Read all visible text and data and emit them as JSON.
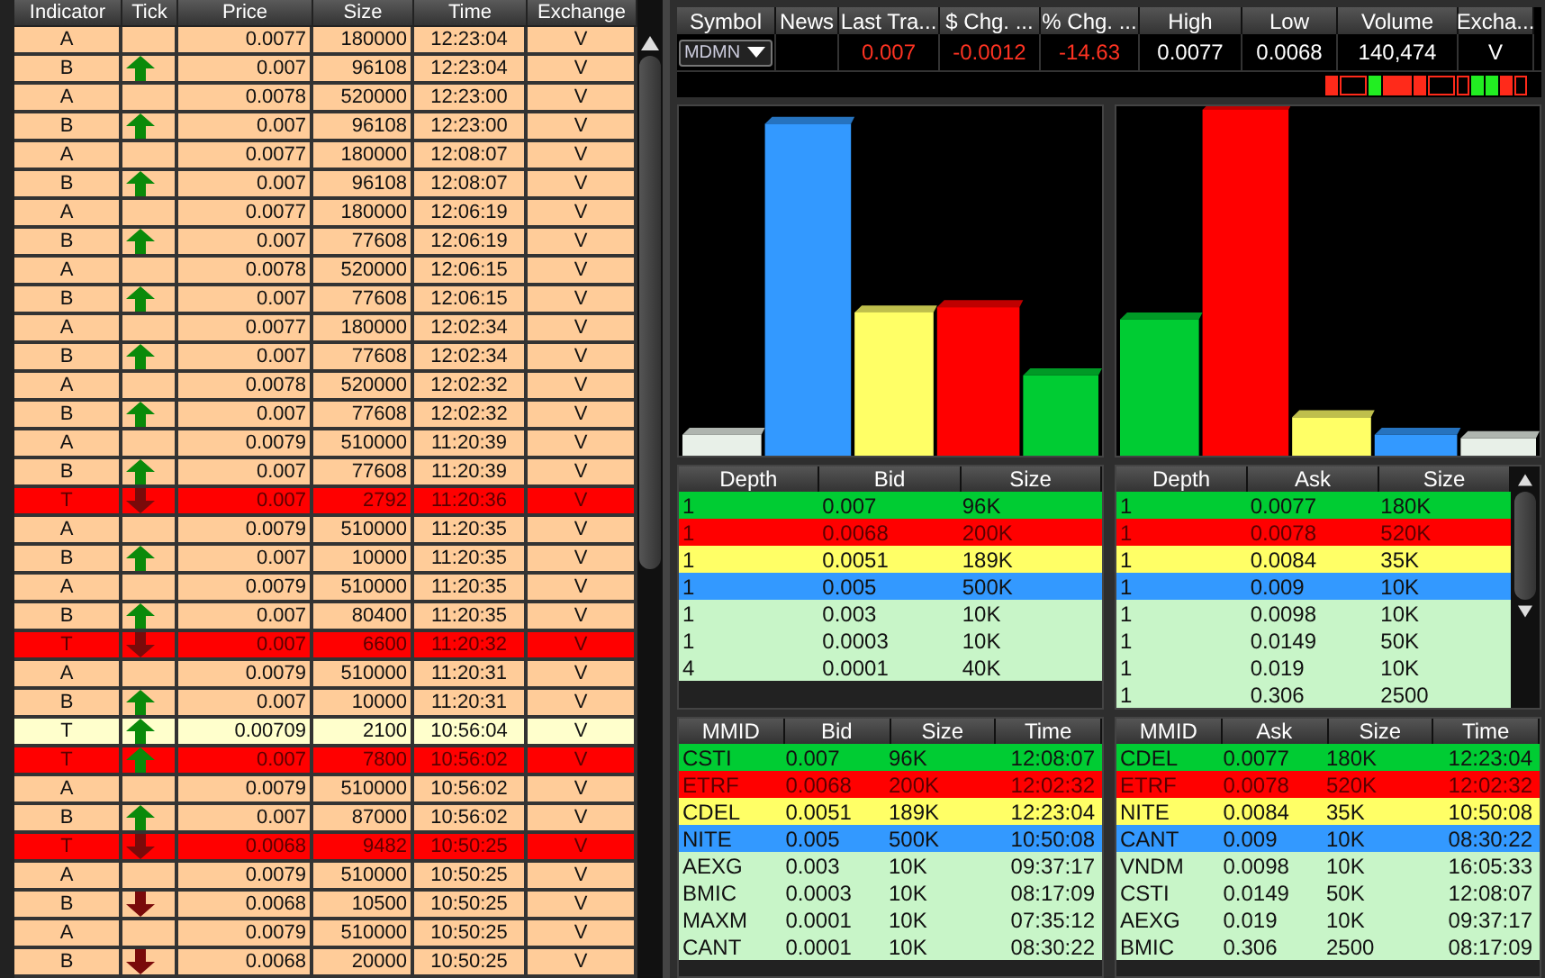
{
  "time_and_sales": {
    "columns": [
      "Indicator",
      "Tick",
      "Price",
      "Size",
      "Time",
      "Exchange"
    ],
    "rows": [
      {
        "indicator": "A",
        "kind": "none",
        "price": "0.0077",
        "size": "180000",
        "time": "12:23:04",
        "exchange": "V",
        "color": "#ffcc99"
      },
      {
        "indicator": "B",
        "kind": "up",
        "price": "0.007",
        "size": "96108",
        "time": "12:23:04",
        "exchange": "V",
        "color": "#ffcc99"
      },
      {
        "indicator": "A",
        "kind": "none",
        "price": "0.0078",
        "size": "520000",
        "time": "12:23:00",
        "exchange": "V",
        "color": "#ffcc99"
      },
      {
        "indicator": "B",
        "kind": "up",
        "price": "0.007",
        "size": "96108",
        "time": "12:23:00",
        "exchange": "V",
        "color": "#ffcc99"
      },
      {
        "indicator": "A",
        "kind": "none",
        "price": "0.0077",
        "size": "180000",
        "time": "12:08:07",
        "exchange": "V",
        "color": "#ffcc99"
      },
      {
        "indicator": "B",
        "kind": "up",
        "price": "0.007",
        "size": "96108",
        "time": "12:08:07",
        "exchange": "V",
        "color": "#ffcc99"
      },
      {
        "indicator": "A",
        "kind": "none",
        "price": "0.0077",
        "size": "180000",
        "time": "12:06:19",
        "exchange": "V",
        "color": "#ffcc99"
      },
      {
        "indicator": "B",
        "kind": "up",
        "price": "0.007",
        "size": "77608",
        "time": "12:06:19",
        "exchange": "V",
        "color": "#ffcc99"
      },
      {
        "indicator": "A",
        "kind": "none",
        "price": "0.0078",
        "size": "520000",
        "time": "12:06:15",
        "exchange": "V",
        "color": "#ffcc99"
      },
      {
        "indicator": "B",
        "kind": "up",
        "price": "0.007",
        "size": "77608",
        "time": "12:06:15",
        "exchange": "V",
        "color": "#ffcc99"
      },
      {
        "indicator": "A",
        "kind": "none",
        "price": "0.0077",
        "size": "180000",
        "time": "12:02:34",
        "exchange": "V",
        "color": "#ffcc99"
      },
      {
        "indicator": "B",
        "kind": "up",
        "price": "0.007",
        "size": "77608",
        "time": "12:02:34",
        "exchange": "V",
        "color": "#ffcc99"
      },
      {
        "indicator": "A",
        "kind": "none",
        "price": "0.0078",
        "size": "520000",
        "time": "12:02:32",
        "exchange": "V",
        "color": "#ffcc99"
      },
      {
        "indicator": "B",
        "kind": "up",
        "price": "0.007",
        "size": "77608",
        "time": "12:02:32",
        "exchange": "V",
        "color": "#ffcc99"
      },
      {
        "indicator": "A",
        "kind": "none",
        "price": "0.0079",
        "size": "510000",
        "time": "11:20:39",
        "exchange": "V",
        "color": "#ffcc99"
      },
      {
        "indicator": "B",
        "kind": "up",
        "price": "0.007",
        "size": "77608",
        "time": "11:20:39",
        "exchange": "V",
        "color": "#ffcc99"
      },
      {
        "indicator": "T",
        "kind": "down",
        "price": "0.007",
        "size": "2792",
        "time": "11:20:36",
        "exchange": "V",
        "color": "#ff0000"
      },
      {
        "indicator": "A",
        "kind": "none",
        "price": "0.0079",
        "size": "510000",
        "time": "11:20:35",
        "exchange": "V",
        "color": "#ffcc99"
      },
      {
        "indicator": "B",
        "kind": "up",
        "price": "0.007",
        "size": "10000",
        "time": "11:20:35",
        "exchange": "V",
        "color": "#ffcc99"
      },
      {
        "indicator": "A",
        "kind": "none",
        "price": "0.0079",
        "size": "510000",
        "time": "11:20:35",
        "exchange": "V",
        "color": "#ffcc99"
      },
      {
        "indicator": "B",
        "kind": "up",
        "price": "0.007",
        "size": "80400",
        "time": "11:20:35",
        "exchange": "V",
        "color": "#ffcc99"
      },
      {
        "indicator": "T",
        "kind": "down",
        "price": "0.007",
        "size": "6600",
        "time": "11:20:32",
        "exchange": "V",
        "color": "#ff0000"
      },
      {
        "indicator": "A",
        "kind": "none",
        "price": "0.0079",
        "size": "510000",
        "time": "11:20:31",
        "exchange": "V",
        "color": "#ffcc99"
      },
      {
        "indicator": "B",
        "kind": "up",
        "price": "0.007",
        "size": "10000",
        "time": "11:20:31",
        "exchange": "V",
        "color": "#ffcc99"
      },
      {
        "indicator": "T",
        "kind": "up",
        "price": "0.00709",
        "size": "2100",
        "time": "10:56:04",
        "exchange": "V",
        "color": "#ffffcc"
      },
      {
        "indicator": "T",
        "kind": "up",
        "price": "0.007",
        "size": "7800",
        "time": "10:56:02",
        "exchange": "V",
        "color": "#ff0000"
      },
      {
        "indicator": "A",
        "kind": "none",
        "price": "0.0079",
        "size": "510000",
        "time": "10:56:02",
        "exchange": "V",
        "color": "#ffcc99"
      },
      {
        "indicator": "B",
        "kind": "up",
        "price": "0.007",
        "size": "87000",
        "time": "10:56:02",
        "exchange": "V",
        "color": "#ffcc99"
      },
      {
        "indicator": "T",
        "kind": "down",
        "price": "0.0068",
        "size": "9482",
        "time": "10:50:25",
        "exchange": "V",
        "color": "#ff0000"
      },
      {
        "indicator": "A",
        "kind": "none",
        "price": "0.0079",
        "size": "510000",
        "time": "10:50:25",
        "exchange": "V",
        "color": "#ffcc99"
      },
      {
        "indicator": "B",
        "kind": "down",
        "price": "0.0068",
        "size": "10500",
        "time": "10:50:25",
        "exchange": "V",
        "color": "#ffcc99"
      },
      {
        "indicator": "A",
        "kind": "none",
        "price": "0.0079",
        "size": "510000",
        "time": "10:50:25",
        "exchange": "V",
        "color": "#ffcc99"
      },
      {
        "indicator": "B",
        "kind": "down",
        "price": "0.0068",
        "size": "20000",
        "time": "10:50:25",
        "exchange": "V",
        "color": "#ffcc99"
      }
    ]
  },
  "quote": {
    "columns": [
      "Symbol",
      "News",
      "Last Tra...",
      "$ Chg. ...",
      "% Chg. ...",
      "High",
      "Low",
      "Volume",
      "Excha..."
    ],
    "symbol": "MDMN",
    "last": "0.007",
    "change": "-0.0012",
    "percent_change": "-14.63",
    "high": "0.0077",
    "low": "0.0068",
    "volume": "140,474",
    "exchange": "V"
  },
  "bid_depth": {
    "columns": [
      "Depth",
      "Bid",
      "Size"
    ],
    "rows": [
      {
        "depth": "1",
        "price": "0.007",
        "size": "96K",
        "color": "#00cc33"
      },
      {
        "depth": "1",
        "price": "0.0068",
        "size": "200K",
        "color": "#ff0000"
      },
      {
        "depth": "1",
        "price": "0.0051",
        "size": "189K",
        "color": "#ffff66"
      },
      {
        "depth": "1",
        "price": "0.005",
        "size": "500K",
        "color": "#3399ff"
      },
      {
        "depth": "1",
        "price": "0.003",
        "size": "10K",
        "color": "#c8f5c8"
      },
      {
        "depth": "1",
        "price": "0.0003",
        "size": "10K",
        "color": "#c8f5c8"
      },
      {
        "depth": "4",
        "price": "0.0001",
        "size": "40K",
        "color": "#c8f5c8"
      }
    ]
  },
  "ask_depth": {
    "columns": [
      "Depth",
      "Ask",
      "Size"
    ],
    "rows": [
      {
        "depth": "1",
        "price": "0.0077",
        "size": "180K",
        "color": "#00cc33"
      },
      {
        "depth": "1",
        "price": "0.0078",
        "size": "520K",
        "color": "#ff0000"
      },
      {
        "depth": "1",
        "price": "0.0084",
        "size": "35K",
        "color": "#ffff66"
      },
      {
        "depth": "1",
        "price": "0.009",
        "size": "10K",
        "color": "#3399ff"
      },
      {
        "depth": "1",
        "price": "0.0098",
        "size": "10K",
        "color": "#c8f5c8"
      },
      {
        "depth": "1",
        "price": "0.0149",
        "size": "50K",
        "color": "#c8f5c8"
      },
      {
        "depth": "1",
        "price": "0.019",
        "size": "10K",
        "color": "#c8f5c8"
      },
      {
        "depth": "1",
        "price": "0.306",
        "size": "2500",
        "color": "#c8f5c8"
      }
    ]
  },
  "bid_mmid": {
    "columns": [
      "MMID",
      "Bid",
      "Size",
      "Time"
    ],
    "rows": [
      {
        "mmid": "CSTI",
        "price": "0.007",
        "size": "96K",
        "time": "12:08:07",
        "color": "#00cc33"
      },
      {
        "mmid": "ETRF",
        "price": "0.0068",
        "size": "200K",
        "time": "12:02:32",
        "color": "#ff0000"
      },
      {
        "mmid": "CDEL",
        "price": "0.0051",
        "size": "189K",
        "time": "12:23:04",
        "color": "#ffff66"
      },
      {
        "mmid": "NITE",
        "price": "0.005",
        "size": "500K",
        "time": "10:50:08",
        "color": "#3399ff"
      },
      {
        "mmid": "AEXG",
        "price": "0.003",
        "size": "10K",
        "time": "09:37:17",
        "color": "#c8f5c8"
      },
      {
        "mmid": "BMIC",
        "price": "0.0003",
        "size": "10K",
        "time": "08:17:09",
        "color": "#c8f5c8"
      },
      {
        "mmid": "MAXM",
        "price": "0.0001",
        "size": "10K",
        "time": "07:35:12",
        "color": "#c8f5c8"
      },
      {
        "mmid": "CANT",
        "price": "0.0001",
        "size": "10K",
        "time": "08:30:22",
        "color": "#c8f5c8"
      }
    ]
  },
  "ask_mmid": {
    "columns": [
      "MMID",
      "Ask",
      "Size",
      "Time"
    ],
    "rows": [
      {
        "mmid": "CDEL",
        "price": "0.0077",
        "size": "180K",
        "time": "12:23:04",
        "color": "#00cc33"
      },
      {
        "mmid": "ETRF",
        "price": "0.0078",
        "size": "520K",
        "time": "12:02:32",
        "color": "#ff0000"
      },
      {
        "mmid": "NITE",
        "price": "0.0084",
        "size": "35K",
        "time": "10:50:08",
        "color": "#ffff66"
      },
      {
        "mmid": "CANT",
        "price": "0.009",
        "size": "10K",
        "time": "08:30:22",
        "color": "#3399ff"
      },
      {
        "mmid": "VNDM",
        "price": "0.0098",
        "size": "10K",
        "time": "16:05:33",
        "color": "#c8f5c8"
      },
      {
        "mmid": "CSTI",
        "price": "0.0149",
        "size": "50K",
        "time": "12:08:07",
        "color": "#c8f5c8"
      },
      {
        "mmid": "AEXG",
        "price": "0.019",
        "size": "10K",
        "time": "09:37:17",
        "color": "#c8f5c8"
      },
      {
        "mmid": "BMIC",
        "price": "0.306",
        "size": "2500",
        "time": "08:17:09",
        "color": "#c8f5c8"
      }
    ]
  }
}
